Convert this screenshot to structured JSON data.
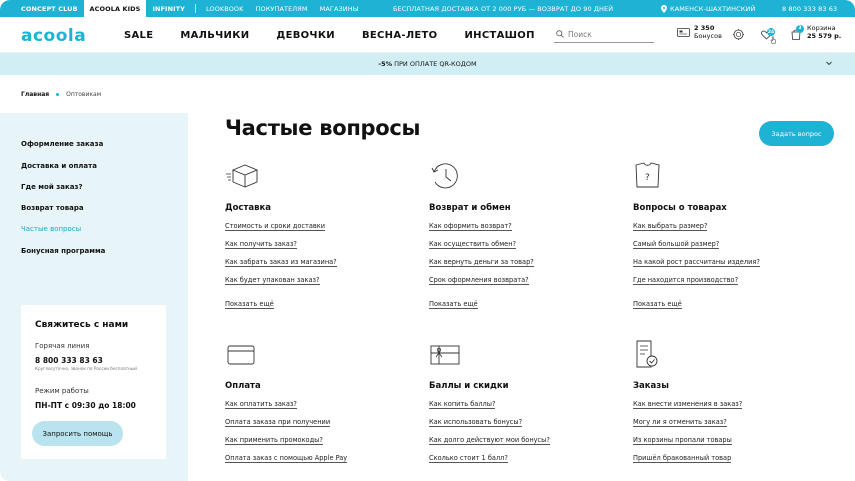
{
  "topbar": {
    "tabs": [
      "CONCEPT CLUB",
      "ACOOLA KIDS",
      "INFINITY"
    ],
    "links": [
      "LOOKBOOK",
      "ПОКУПАТЕЛЯМ",
      "МАГАЗИНЫ"
    ],
    "promo": "БЕСПЛАТНАЯ ДОСТАВКА ОТ 2 000 РУБ — ВОЗВРАТ ДО 90 ДНЕЙ",
    "city": "КАМЕНСК-ШАХТИНСКИЙ",
    "phone": "8 800 333 83 63"
  },
  "header": {
    "logo_text": "acoola",
    "nav": [
      "SALE",
      "МАЛЬЧИКИ",
      "ДЕВОЧКИ",
      "ВЕСНА-ЛЕТО",
      "ИНСТАШОП"
    ],
    "search_placeholder": "Поиск",
    "bonus_amount": "2 350",
    "bonus_label": "Бонусов",
    "favorites_count": "24",
    "cart_count": "3",
    "cart_label": "Корзина",
    "cart_total": "25 579 р."
  },
  "qr_banner": {
    "discount": "-5%",
    "text": "ПРИ ОПЛАТЕ QR-КОДОМ"
  },
  "breadcrumb": {
    "home": "Главная",
    "current": "Оптовикам"
  },
  "sidebar": {
    "items": [
      "Оформление заказа",
      "Доставка и оплата",
      "Где мой заказ?",
      "Возврат товара",
      "Частые вопросы",
      "Бонусная программа"
    ],
    "active_index": 4,
    "contact": {
      "title": "Свяжитесь с нами",
      "hotline_label": "Горячая линия",
      "phone": "8 800 333 83 63",
      "phone_note": "Круглосуточно, звонок по России бесплатный",
      "hours_label": "Режим работы",
      "hours": "ПН-ПТ с 09:30 до 18:00",
      "help_button": "Запросить помощь"
    }
  },
  "main": {
    "title": "Частые вопросы",
    "ask_button": "Задать вопрос",
    "show_more": "Показать ещё",
    "sections": [
      {
        "icon": "box-icon",
        "title": "Доставка",
        "questions": [
          "Стоимость и сроки доставки",
          "Как получить заказ?",
          "Как забрать заказ из магазина?",
          "Как будет упакован заказ?"
        ]
      },
      {
        "icon": "return-clock-icon",
        "title": "Возврат и обмен",
        "questions": [
          "Как оформить возврат?",
          "Как осуществить обмен?",
          "Как вернуть деньги за товар?",
          "Срок оформления возврата?"
        ]
      },
      {
        "icon": "shirt-question-icon",
        "title": "Вопросы о товарах",
        "questions": [
          "Как выбрать размер?",
          "Самый большой размер?",
          "На какой рост рассчитаны изделия?",
          "Где находится производство?"
        ]
      },
      {
        "icon": "card-icon",
        "title": "Оплата",
        "questions": [
          "Как оплатить заказ?",
          "Оплата заказа при получении",
          "Как применить промокоды?",
          "Оплата заказ с помощью Apple Pay"
        ]
      },
      {
        "icon": "gift-card-icon",
        "title": "Баллы и скидки",
        "questions": [
          "Как копить баллы?",
          "Как использовать бонусы?",
          "Как долго действуют мои бонусы?",
          "Сколько стоит 1 балл?"
        ]
      },
      {
        "icon": "receipt-check-icon",
        "title": "Заказы",
        "questions": [
          "Как внести изменения в заказ?",
          "Могу ли я отменить заказ?",
          "Из корзины пропали товары",
          "Пришёл бракованный товар"
        ]
      }
    ]
  }
}
